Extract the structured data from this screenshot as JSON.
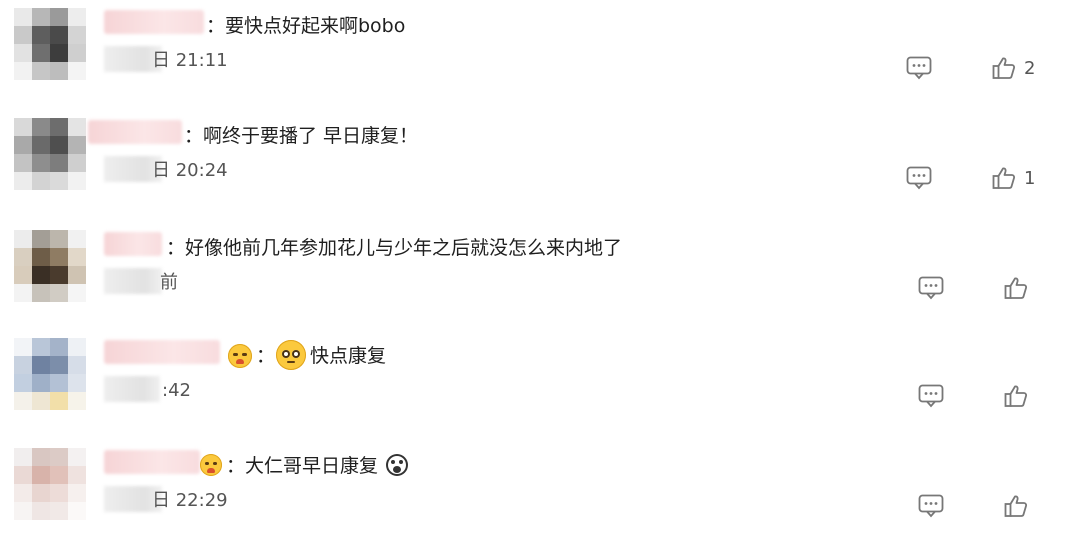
{
  "comments": [
    {
      "text": "：要快点好起来啊bobo",
      "time": "日 21:11",
      "like_count": "2",
      "colors": {
        "avatar": [
          "#e9e9e9",
          "#b7b7b7",
          "#9a9a9a",
          "#ededed",
          "#c9c9c9",
          "#5e5e5e",
          "#4a4a4a",
          "#d4d4d4",
          "#e2e2e2",
          "#6f6f6f",
          "#3d3d3d",
          "#cfcfcf",
          "#f2f2f2",
          "#c6c6c6",
          "#bdbdbd",
          "#f4f4f4"
        ]
      }
    },
    {
      "text": "：啊终于要播了 早日康复！",
      "time": "日 20:24",
      "like_count": "1",
      "colors": {
        "avatar": [
          "#d9d9d9",
          "#8a8a8a",
          "#6d6d6d",
          "#e4e4e4",
          "#a9a9a9",
          "#6a6a6a",
          "#4f4f4f",
          "#b4b4b4",
          "#c3c3c3",
          "#8e8e8e",
          "#7d7d7d",
          "#cfcfcf",
          "#ececec",
          "#d3d3d3",
          "#dadada",
          "#f2f2f2"
        ]
      }
    },
    {
      "text": "：好像他前几年参加花儿与少年之后就没怎么来内地了",
      "time": "前",
      "like_count": "",
      "colors": {
        "avatar": [
          "#ececec",
          "#a39e96",
          "#bcb6ac",
          "#f1f1f1",
          "#d9cfc0",
          "#6e5d48",
          "#8f7c63",
          "#e2d8c9",
          "#d8ccbb",
          "#3a2f25",
          "#4a3b2d",
          "#cfc3b2",
          "#f3f3f3",
          "#c7c2ba",
          "#d1ccc4",
          "#f5f5f5"
        ]
      }
    },
    {
      "text": "：",
      "text2": "快点康复",
      "time": ":42",
      "like_count": "",
      "colors": {
        "avatar": [
          "#f2f4f7",
          "#b9c6d8",
          "#a4b3c9",
          "#eef1f5",
          "#c8d2e0",
          "#6f82a1",
          "#7c8eaa",
          "#d6dde8",
          "#c2cfe0",
          "#9fb0c8",
          "#b3c1d5",
          "#dde3ec",
          "#f4f1ea",
          "#eee6d3",
          "#f2dfa9",
          "#f6f3ea"
        ]
      }
    },
    {
      "text": "：大仁哥早日康复",
      "time": "日 22:29",
      "like_count": "",
      "colors": {
        "avatar": [
          "#f1eeee",
          "#d9c7c2",
          "#dccbc6",
          "#f4f1f1",
          "#ead9d5",
          "#d8b3aa",
          "#e1c1b9",
          "#efe2df",
          "#f3ebe9",
          "#e8d5d0",
          "#eddcd8",
          "#f6f0ee",
          "#f7f4f3",
          "#efe6e4",
          "#f1e9e7",
          "#fbf9f8"
        ]
      }
    }
  ],
  "theme": {
    "icon_color": "#7a7a7a",
    "emoji_yellow": "#fbc93d",
    "emoji_edge": "#e0a51e"
  }
}
